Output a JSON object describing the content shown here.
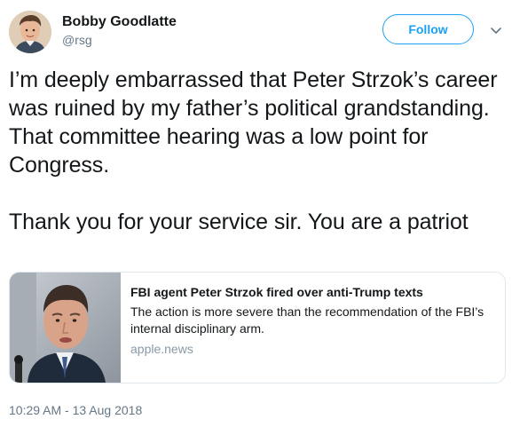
{
  "user": {
    "display_name": "Bobby Goodlatte",
    "handle": "@rsg",
    "avatar_icon": "user-avatar-photo"
  },
  "actions": {
    "follow_label": "Follow",
    "menu_icon": "chevron-down-icon"
  },
  "tweet": {
    "paragraphs": [
      "I’m deeply embarrassed that Peter Strzok’s career was ruined by my father’s political grandstanding. That committee hearing was a low point for Congress.",
      "Thank you for your service sir. You are a patriot"
    ]
  },
  "card": {
    "title": "FBI agent Peter Strzok fired over anti-Trump texts",
    "description": "The action is more severe than the recommendation of the FBI’s internal disciplinary arm.",
    "domain": "apple.news",
    "image_icon": "news-thumbnail-photo"
  },
  "timestamp": "10:29 AM - 13 Aug 2018",
  "colors": {
    "accent": "#1da1f2",
    "text": "#14171a",
    "muted": "#657786",
    "border": "#e1e8ed"
  }
}
